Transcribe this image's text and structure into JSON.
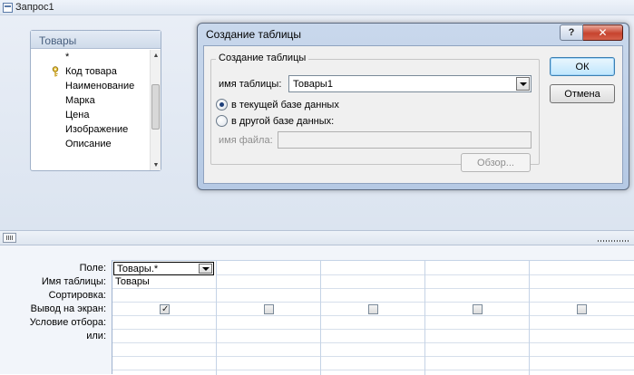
{
  "window": {
    "title": "Запрос1"
  },
  "table_box": {
    "title": "Товары",
    "fields": [
      "*",
      "Код товара",
      "Наименование",
      "Марка",
      "Цена",
      "Изображение",
      "Описание"
    ],
    "key_field_index": 1
  },
  "dialog": {
    "title": "Создание таблицы",
    "help_label": "?",
    "close_label": "✕",
    "group_label": "Создание таблицы",
    "name_label": "имя таблицы:",
    "name_value": "Товары1",
    "radio_current": "в текущей базе данных",
    "radio_other": "в другой базе данных:",
    "selected_radio": "current",
    "file_label": "имя файла:",
    "file_value": "",
    "browse_label": "Обзор...",
    "ok_label": "ОК",
    "cancel_label": "Отмена"
  },
  "grid": {
    "row_labels": [
      "Поле:",
      "Имя таблицы:",
      "Сортировка:",
      "Вывод на экран:",
      "Условие отбора:",
      "или:"
    ],
    "columns": [
      {
        "field": "Товары.*",
        "table": "Товары",
        "show": true
      },
      {
        "field": "",
        "table": "",
        "show": false
      },
      {
        "field": "",
        "table": "",
        "show": false
      },
      {
        "field": "",
        "table": "",
        "show": false
      },
      {
        "field": "",
        "table": "",
        "show": false
      }
    ]
  }
}
